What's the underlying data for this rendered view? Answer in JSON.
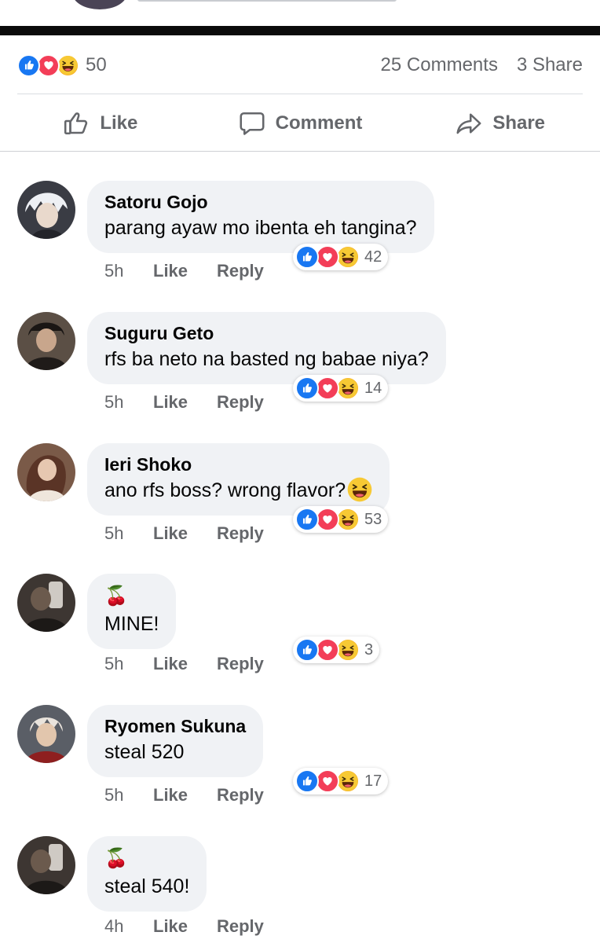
{
  "post": {
    "reaction_total": "50",
    "comments_count": "25 Comments",
    "share_count": "3 Share"
  },
  "actions": {
    "like_label": "Like",
    "comment_label": "Comment",
    "share_label": "Share"
  },
  "comments": [
    {
      "name": "Satoru Gojo",
      "text": "parang ayaw mo ibenta eh tangina?",
      "time": "5h",
      "like": "Like",
      "reply": "Reply",
      "reactions": "42"
    },
    {
      "name": "Suguru Geto",
      "text": "rfs ba neto na basted ng babae niya?",
      "time": "5h",
      "like": "Like",
      "reply": "Reply",
      "reactions": "14"
    },
    {
      "name": "Ieri Shoko",
      "text": "ano rfs boss? wrong flavor?",
      "time": "5h",
      "like": "Like",
      "reply": "Reply",
      "reactions": "53"
    },
    {
      "name": "🍒",
      "text": "MINE!",
      "time": "5h",
      "like": "Like",
      "reply": "Reply",
      "reactions": "3"
    },
    {
      "name": "Ryomen Sukuna",
      "text": "steal 520",
      "time": "5h",
      "like": "Like",
      "reply": "Reply",
      "reactions": "17"
    },
    {
      "name": "🍒",
      "text": "steal 540!",
      "time": "4h",
      "like": "Like",
      "reply": "Reply",
      "reactions": ""
    }
  ],
  "icons": {
    "like_reaction": "like-reaction-icon",
    "love_reaction": "love-reaction-icon",
    "haha_reaction": "haha-reaction-icon",
    "like_action": "thumbs-up-icon",
    "comment_action": "speech-bubble-icon",
    "share_action": "share-arrow-icon",
    "grinning_emoji": "grinning-squinting-face-icon"
  },
  "colors": {
    "like_blue": "#1877f2",
    "love_red": "#f33e58",
    "haha_yellow": "#f7b125",
    "secondary_text": "#65676b",
    "bubble_bg": "#f0f2f5"
  }
}
